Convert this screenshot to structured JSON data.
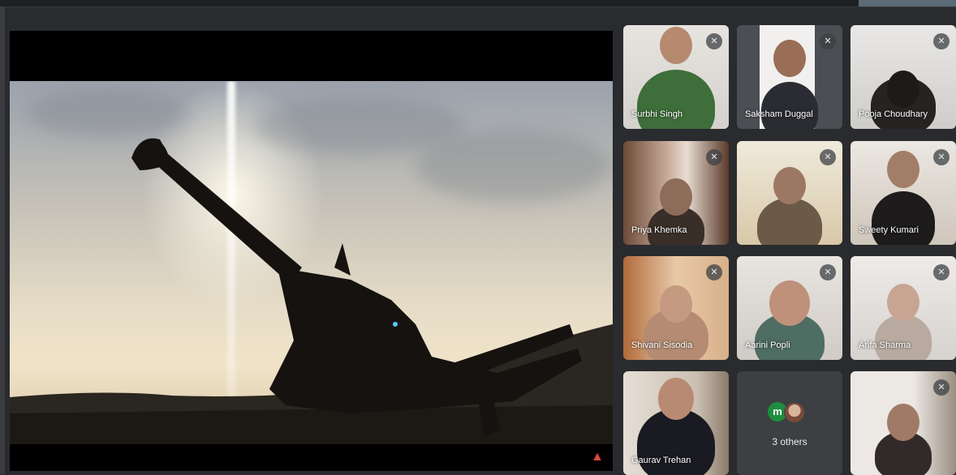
{
  "participants": [
    {
      "name": "Surbhi Singh",
      "mic": "muted"
    },
    {
      "name": "Saksham Duggal",
      "mic": "muted"
    },
    {
      "name": "Pooja Choudhary",
      "mic": "muted"
    },
    {
      "name": "Priya Khemka",
      "mic": "muted"
    },
    {
      "name": "",
      "mic": "muted"
    },
    {
      "name": "Sweety Kumari",
      "mic": "muted"
    },
    {
      "name": "Shivani Sisodia",
      "mic": "muted"
    },
    {
      "name": "Aarini Popli",
      "mic": "muted"
    },
    {
      "name": "Arifa Sharma",
      "mic": "muted"
    },
    {
      "name": "Gaurav Trehan",
      "mic": "unmuted"
    },
    {
      "name": "",
      "mic": "muted"
    }
  ],
  "others": {
    "avatar_letter": "m",
    "label": "3 others"
  },
  "colors": {
    "background": "#2a2b2e",
    "tile": "#3c4043",
    "present_icon": "#e0463d",
    "avatar_green": "#1e8e3e"
  },
  "icons": {
    "mic_off": "mic-off-icon",
    "present": "present-icon"
  }
}
